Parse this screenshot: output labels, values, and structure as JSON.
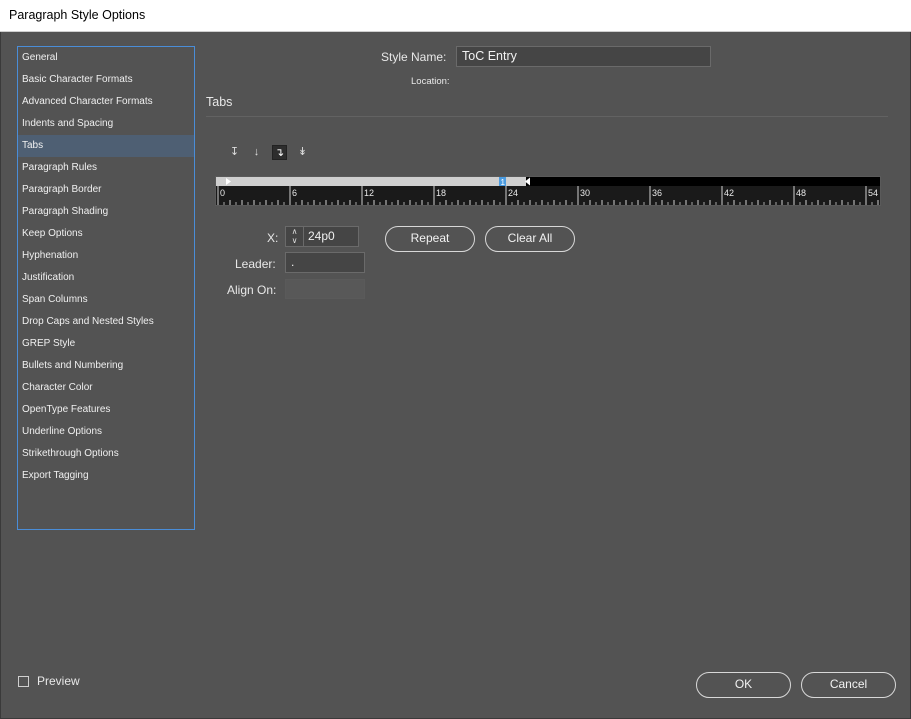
{
  "window": {
    "title": "Paragraph Style Options"
  },
  "sidebar": {
    "items": [
      {
        "label": "General"
      },
      {
        "label": "Basic Character Formats"
      },
      {
        "label": "Advanced Character Formats"
      },
      {
        "label": "Indents and Spacing"
      },
      {
        "label": "Tabs",
        "selected": true
      },
      {
        "label": "Paragraph Rules"
      },
      {
        "label": "Paragraph Border"
      },
      {
        "label": "Paragraph Shading"
      },
      {
        "label": "Keep Options"
      },
      {
        "label": "Hyphenation"
      },
      {
        "label": "Justification"
      },
      {
        "label": "Span Columns"
      },
      {
        "label": "Drop Caps and Nested Styles"
      },
      {
        "label": "GREP Style"
      },
      {
        "label": "Bullets and Numbering"
      },
      {
        "label": "Character Color"
      },
      {
        "label": "OpenType Features"
      },
      {
        "label": "Underline Options"
      },
      {
        "label": "Strikethrough Options"
      },
      {
        "label": "Export Tagging"
      }
    ]
  },
  "header": {
    "style_name_label": "Style Name:",
    "style_name_value": "ToC Entry",
    "location_label": "Location:"
  },
  "tabs_panel": {
    "section_title": "Tabs",
    "alignment_buttons": [
      {
        "icon": "left-justified-tab-icon"
      },
      {
        "icon": "center-justified-tab-icon"
      },
      {
        "icon": "right-justified-tab-icon",
        "active": true
      },
      {
        "icon": "align-to-decimal-tab-icon"
      }
    ],
    "ruler": {
      "labels": [
        "0",
        "6",
        "12",
        "18",
        "24",
        "30",
        "36",
        "42",
        "48",
        "54"
      ],
      "tab_marker_label": "1",
      "tab_position_picas": 24
    },
    "x_label": "X:",
    "x_value": "24p0",
    "leader_label": "Leader:",
    "leader_value": ".",
    "align_on_label": "Align On:",
    "align_on_value": "",
    "repeat_label": "Repeat",
    "clear_all_label": "Clear All"
  },
  "footer": {
    "preview_label": "Preview",
    "preview_checked": false,
    "ok_label": "OK",
    "cancel_label": "Cancel"
  },
  "colors": {
    "background": "#535353",
    "selection": "#4e5f73",
    "focus_border": "#4a8dd8",
    "tab_marker": "#4a9be0"
  }
}
